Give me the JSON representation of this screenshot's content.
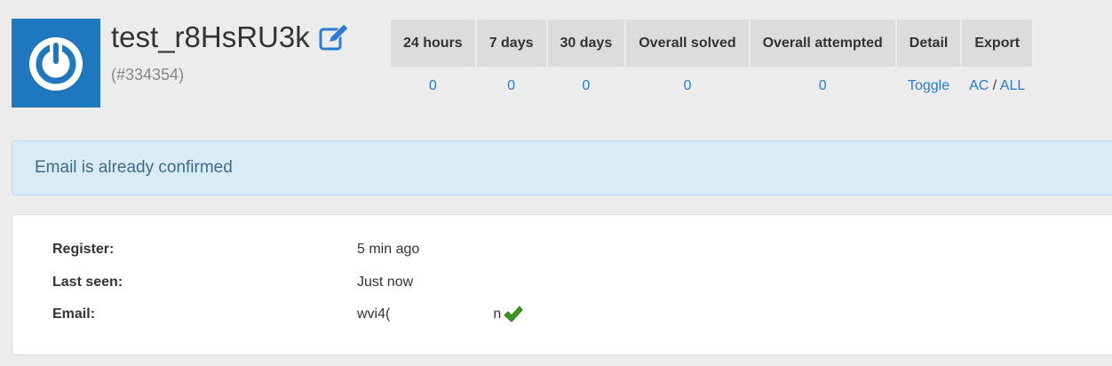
{
  "profile": {
    "username": "test_r8HsRU3k",
    "user_id": "(#334354)"
  },
  "stats": {
    "headers": [
      "24 hours",
      "7 days",
      "30 days",
      "Overall solved",
      "Overall attempted",
      "Detail",
      "Export"
    ],
    "values": [
      "0",
      "0",
      "0",
      "0",
      "0"
    ],
    "detail_link": "Toggle",
    "export_ac": "AC",
    "export_sep": "/",
    "export_all": "ALL"
  },
  "alert": {
    "text": "Email is already confirmed"
  },
  "info": {
    "register_label": "Register:",
    "register_value": "5 min ago",
    "last_seen_label": "Last seen:",
    "last_seen_value": "Just now",
    "email_label": "Email:",
    "email_value_start": "wvi4(",
    "email_value_end": "n"
  },
  "colors": {
    "avatar_bg": "#1f77bd",
    "link": "#2a7bd4",
    "alert_bg": "#d9ecf5",
    "check": "#3a9a1c"
  },
  "icons": {
    "avatar": "power-icon",
    "edit": "edit-icon",
    "verified": "check-icon"
  }
}
